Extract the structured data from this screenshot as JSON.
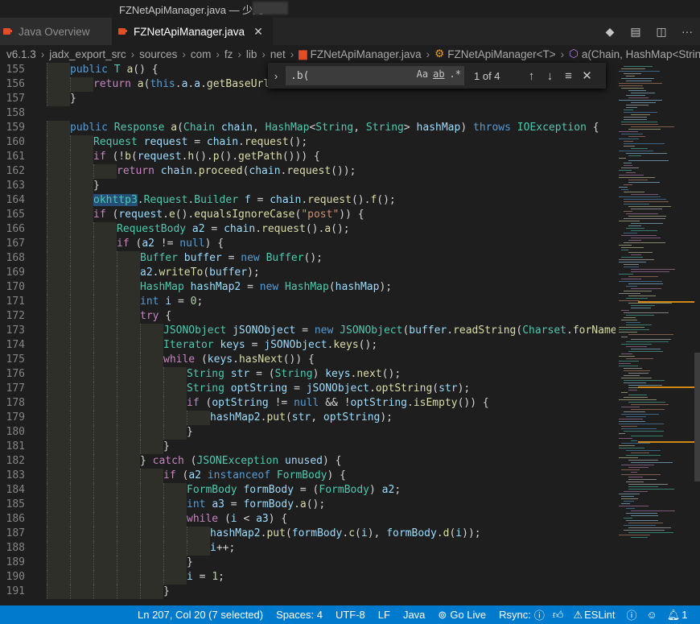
{
  "window": {
    "title": "FZNetApiManager.java — 少儿"
  },
  "tabs": [
    {
      "label": "Java Overview",
      "active": false
    },
    {
      "label": "FZNetApiManager.java",
      "active": true
    }
  ],
  "tab_actions": [
    "git-compare-icon",
    "open-preview-icon",
    "split-editor-icon",
    "more-actions-icon"
  ],
  "breadcrumb": [
    "v6.1.3",
    "jadx_export_src",
    "sources",
    "com",
    "fz",
    "lib",
    "net",
    "FZNetApiManager.java",
    "FZNetApiManager<T>",
    "a(Chain, HashMap<Strin"
  ],
  "find": {
    "query": ".b(",
    "match_case": "Aa",
    "whole_word": "ab",
    "regex": ".*",
    "count": "1 of 4"
  },
  "code_lines": [
    {
      "n": "155",
      "indent": 1,
      "tokens": [
        [
          "kw",
          "public "
        ],
        [
          "ty",
          "T "
        ],
        [
          "fn",
          "a"
        ],
        [
          "pl",
          "() {"
        ]
      ]
    },
    {
      "n": "156",
      "indent": 2,
      "tokens": [
        [
          "ctl",
          "return "
        ],
        [
          "fn",
          "a"
        ],
        [
          "pl",
          "("
        ],
        [
          "kw",
          "this"
        ],
        [
          "pl",
          "."
        ],
        [
          "var",
          "a"
        ],
        [
          "pl",
          "."
        ],
        [
          "var",
          "a"
        ],
        [
          "pl",
          "."
        ],
        [
          "fn",
          "getBaseUrl"
        ],
        [
          "pl",
          "()"
        ]
      ]
    },
    {
      "n": "157",
      "indent": 1,
      "tokens": [
        [
          "pl",
          "}"
        ]
      ]
    },
    {
      "n": "158",
      "indent": 0,
      "tokens": []
    },
    {
      "n": "159",
      "indent": 1,
      "tokens": [
        [
          "kw",
          "public "
        ],
        [
          "ty",
          "Response "
        ],
        [
          "fn",
          "a"
        ],
        [
          "pl",
          "("
        ],
        [
          "ty",
          "Chain "
        ],
        [
          "var",
          "chain"
        ],
        [
          "pl",
          ", "
        ],
        [
          "ty",
          "HashMap"
        ],
        [
          "pl",
          "<"
        ],
        [
          "ty",
          "String"
        ],
        [
          "pl",
          ", "
        ],
        [
          "ty",
          "String"
        ],
        [
          "pl",
          "> "
        ],
        [
          "var",
          "hashMap"
        ],
        [
          "pl",
          ") "
        ],
        [
          "kw",
          "throws "
        ],
        [
          "ty",
          "IOException"
        ],
        [
          "pl",
          " {"
        ]
      ]
    },
    {
      "n": "160",
      "indent": 2,
      "tokens": [
        [
          "ty",
          "Request "
        ],
        [
          "var",
          "request"
        ],
        [
          "pl",
          " = "
        ],
        [
          "var",
          "chain"
        ],
        [
          "pl",
          "."
        ],
        [
          "fn",
          "request"
        ],
        [
          "pl",
          "();"
        ]
      ]
    },
    {
      "n": "161",
      "indent": 2,
      "tokens": [
        [
          "ctl",
          "if "
        ],
        [
          "pl",
          "(!"
        ],
        [
          "fn",
          "b"
        ],
        [
          "pl",
          "("
        ],
        [
          "var",
          "request"
        ],
        [
          "pl",
          "."
        ],
        [
          "fn",
          "h"
        ],
        [
          "pl",
          "()."
        ],
        [
          "fn",
          "p"
        ],
        [
          "pl",
          "()."
        ],
        [
          "fn",
          "getPath"
        ],
        [
          "pl",
          "())) {"
        ]
      ]
    },
    {
      "n": "162",
      "indent": 3,
      "tokens": [
        [
          "ctl",
          "return "
        ],
        [
          "var",
          "chain"
        ],
        [
          "pl",
          "."
        ],
        [
          "fn",
          "proceed"
        ],
        [
          "pl",
          "("
        ],
        [
          "var",
          "chain"
        ],
        [
          "pl",
          "."
        ],
        [
          "fn",
          "request"
        ],
        [
          "pl",
          "());"
        ]
      ]
    },
    {
      "n": "163",
      "indent": 2,
      "tokens": [
        [
          "pl",
          "}"
        ]
      ]
    },
    {
      "n": "164",
      "indent": 2,
      "tokens": [
        [
          "sel",
          "okhttp3"
        ],
        [
          "pl",
          "."
        ],
        [
          "ty",
          "Request"
        ],
        [
          "pl",
          "."
        ],
        [
          "ty",
          "Builder "
        ],
        [
          "var",
          "f"
        ],
        [
          "pl",
          " = "
        ],
        [
          "var",
          "chain"
        ],
        [
          "pl",
          "."
        ],
        [
          "fn",
          "request"
        ],
        [
          "pl",
          "()."
        ],
        [
          "fn",
          "f"
        ],
        [
          "pl",
          "();"
        ]
      ]
    },
    {
      "n": "165",
      "indent": 2,
      "tokens": [
        [
          "ctl",
          "if "
        ],
        [
          "pl",
          "("
        ],
        [
          "var",
          "request"
        ],
        [
          "pl",
          "."
        ],
        [
          "fn",
          "e"
        ],
        [
          "pl",
          "()."
        ],
        [
          "fn",
          "equalsIgnoreCase"
        ],
        [
          "pl",
          "("
        ],
        [
          "str",
          "\"post\""
        ],
        [
          "pl",
          ")) {"
        ]
      ]
    },
    {
      "n": "166",
      "indent": 3,
      "tokens": [
        [
          "ty",
          "RequestBody "
        ],
        [
          "var",
          "a2"
        ],
        [
          "pl",
          " = "
        ],
        [
          "var",
          "chain"
        ],
        [
          "pl",
          "."
        ],
        [
          "fn",
          "request"
        ],
        [
          "pl",
          "()."
        ],
        [
          "fn",
          "a"
        ],
        [
          "pl",
          "();"
        ]
      ]
    },
    {
      "n": "167",
      "indent": 3,
      "tokens": [
        [
          "ctl",
          "if "
        ],
        [
          "pl",
          "("
        ],
        [
          "var",
          "a2"
        ],
        [
          "pl",
          " != "
        ],
        [
          "kw",
          "null"
        ],
        [
          "pl",
          ") {"
        ]
      ]
    },
    {
      "n": "168",
      "indent": 4,
      "tokens": [
        [
          "ty",
          "Buffer "
        ],
        [
          "var",
          "buffer"
        ],
        [
          "pl",
          " = "
        ],
        [
          "kw",
          "new "
        ],
        [
          "ty",
          "Buffer"
        ],
        [
          "pl",
          "();"
        ]
      ]
    },
    {
      "n": "169",
      "indent": 4,
      "tokens": [
        [
          "var",
          "a2"
        ],
        [
          "pl",
          "."
        ],
        [
          "fn",
          "writeTo"
        ],
        [
          "pl",
          "("
        ],
        [
          "var",
          "buffer"
        ],
        [
          "pl",
          ");"
        ]
      ]
    },
    {
      "n": "170",
      "indent": 4,
      "tokens": [
        [
          "ty",
          "HashMap "
        ],
        [
          "var",
          "hashMap2"
        ],
        [
          "pl",
          " = "
        ],
        [
          "kw",
          "new "
        ],
        [
          "ty",
          "HashMap"
        ],
        [
          "pl",
          "("
        ],
        [
          "var",
          "hashMap"
        ],
        [
          "pl",
          ");"
        ]
      ]
    },
    {
      "n": "171",
      "indent": 4,
      "tokens": [
        [
          "kw",
          "int "
        ],
        [
          "var",
          "i"
        ],
        [
          "pl",
          " = "
        ],
        [
          "num",
          "0"
        ],
        [
          "pl",
          ";"
        ]
      ]
    },
    {
      "n": "172",
      "indent": 4,
      "tokens": [
        [
          "ctl",
          "try "
        ],
        [
          "pl",
          "{"
        ]
      ]
    },
    {
      "n": "173",
      "indent": 5,
      "tokens": [
        [
          "ty",
          "JSONObject "
        ],
        [
          "var",
          "jSONObject"
        ],
        [
          "pl",
          " = "
        ],
        [
          "kw",
          "new "
        ],
        [
          "ty",
          "JSONObject"
        ],
        [
          "pl",
          "("
        ],
        [
          "var",
          "buffer"
        ],
        [
          "pl",
          "."
        ],
        [
          "fn",
          "readString"
        ],
        [
          "pl",
          "("
        ],
        [
          "ty",
          "Charset"
        ],
        [
          "pl",
          "."
        ],
        [
          "fn",
          "forName"
        ],
        [
          "pl",
          "("
        ],
        [
          "str",
          "\"UTF-"
        ]
      ]
    },
    {
      "n": "174",
      "indent": 5,
      "tokens": [
        [
          "ty",
          "Iterator "
        ],
        [
          "var",
          "keys"
        ],
        [
          "pl",
          " = "
        ],
        [
          "var",
          "jSONObject"
        ],
        [
          "pl",
          "."
        ],
        [
          "fn",
          "keys"
        ],
        [
          "pl",
          "();"
        ]
      ]
    },
    {
      "n": "175",
      "indent": 5,
      "tokens": [
        [
          "ctl",
          "while "
        ],
        [
          "pl",
          "("
        ],
        [
          "var",
          "keys"
        ],
        [
          "pl",
          "."
        ],
        [
          "fn",
          "hasNext"
        ],
        [
          "pl",
          "()) {"
        ]
      ]
    },
    {
      "n": "176",
      "indent": 6,
      "tokens": [
        [
          "ty",
          "String "
        ],
        [
          "var",
          "str"
        ],
        [
          "pl",
          " = ("
        ],
        [
          "ty",
          "String"
        ],
        [
          "pl",
          ") "
        ],
        [
          "var",
          "keys"
        ],
        [
          "pl",
          "."
        ],
        [
          "fn",
          "next"
        ],
        [
          "pl",
          "();"
        ]
      ]
    },
    {
      "n": "177",
      "indent": 6,
      "tokens": [
        [
          "ty",
          "String "
        ],
        [
          "var",
          "optString"
        ],
        [
          "pl",
          " = "
        ],
        [
          "var",
          "jSONObject"
        ],
        [
          "pl",
          "."
        ],
        [
          "fn",
          "optString"
        ],
        [
          "pl",
          "("
        ],
        [
          "var",
          "str"
        ],
        [
          "pl",
          ");"
        ]
      ]
    },
    {
      "n": "178",
      "indent": 6,
      "tokens": [
        [
          "ctl",
          "if "
        ],
        [
          "pl",
          "("
        ],
        [
          "var",
          "optString"
        ],
        [
          "pl",
          " != "
        ],
        [
          "kw",
          "null"
        ],
        [
          "pl",
          " && !"
        ],
        [
          "var",
          "optString"
        ],
        [
          "pl",
          "."
        ],
        [
          "fn",
          "isEmpty"
        ],
        [
          "pl",
          "()) {"
        ]
      ]
    },
    {
      "n": "179",
      "indent": 7,
      "tokens": [
        [
          "var",
          "hashMap2"
        ],
        [
          "pl",
          "."
        ],
        [
          "fn",
          "put"
        ],
        [
          "pl",
          "("
        ],
        [
          "var",
          "str"
        ],
        [
          "pl",
          ", "
        ],
        [
          "var",
          "optString"
        ],
        [
          "pl",
          ");"
        ]
      ]
    },
    {
      "n": "180",
      "indent": 6,
      "tokens": [
        [
          "pl",
          "}"
        ]
      ]
    },
    {
      "n": "181",
      "indent": 5,
      "tokens": [
        [
          "pl",
          "}"
        ]
      ]
    },
    {
      "n": "182",
      "indent": 4,
      "tokens": [
        [
          "pl",
          "} "
        ],
        [
          "ctl",
          "catch "
        ],
        [
          "pl",
          "("
        ],
        [
          "ty",
          "JSONException "
        ],
        [
          "var",
          "unused"
        ],
        [
          "pl",
          ") {"
        ]
      ]
    },
    {
      "n": "183",
      "indent": 5,
      "tokens": [
        [
          "ctl",
          "if "
        ],
        [
          "pl",
          "("
        ],
        [
          "var",
          "a2"
        ],
        [
          "kw",
          " instanceof "
        ],
        [
          "ty",
          "FormBody"
        ],
        [
          "pl",
          ") {"
        ]
      ]
    },
    {
      "n": "184",
      "indent": 6,
      "tokens": [
        [
          "ty",
          "FormBody "
        ],
        [
          "var",
          "formBody"
        ],
        [
          "pl",
          " = ("
        ],
        [
          "ty",
          "FormBody"
        ],
        [
          "pl",
          ") "
        ],
        [
          "var",
          "a2"
        ],
        [
          "pl",
          ";"
        ]
      ]
    },
    {
      "n": "185",
      "indent": 6,
      "tokens": [
        [
          "kw",
          "int "
        ],
        [
          "var",
          "a3"
        ],
        [
          "pl",
          " = "
        ],
        [
          "var",
          "formBody"
        ],
        [
          "pl",
          "."
        ],
        [
          "fn",
          "a"
        ],
        [
          "pl",
          "();"
        ]
      ]
    },
    {
      "n": "186",
      "indent": 6,
      "tokens": [
        [
          "ctl",
          "while "
        ],
        [
          "pl",
          "("
        ],
        [
          "var",
          "i"
        ],
        [
          "pl",
          " < "
        ],
        [
          "var",
          "a3"
        ],
        [
          "pl",
          ") {"
        ]
      ]
    },
    {
      "n": "187",
      "indent": 7,
      "tokens": [
        [
          "var",
          "hashMap2"
        ],
        [
          "pl",
          "."
        ],
        [
          "fn",
          "put"
        ],
        [
          "pl",
          "("
        ],
        [
          "var",
          "formBody"
        ],
        [
          "pl",
          "."
        ],
        [
          "fn",
          "c"
        ],
        [
          "pl",
          "("
        ],
        [
          "var",
          "i"
        ],
        [
          "pl",
          "), "
        ],
        [
          "var",
          "formBody"
        ],
        [
          "pl",
          "."
        ],
        [
          "fn",
          "d"
        ],
        [
          "pl",
          "("
        ],
        [
          "var",
          "i"
        ],
        [
          "pl",
          "));"
        ]
      ]
    },
    {
      "n": "188",
      "indent": 7,
      "tokens": [
        [
          "var",
          "i"
        ],
        [
          "pl",
          "++;"
        ]
      ]
    },
    {
      "n": "189",
      "indent": 6,
      "tokens": [
        [
          "pl",
          "}"
        ]
      ]
    },
    {
      "n": "190",
      "indent": 6,
      "tokens": [
        [
          "var",
          "i"
        ],
        [
          "pl",
          " = "
        ],
        [
          "num",
          "1"
        ],
        [
          "pl",
          ";"
        ]
      ]
    },
    {
      "n": "191",
      "indent": 5,
      "tokens": [
        [
          "pl",
          "}"
        ]
      ]
    }
  ],
  "status": {
    "position": "Ln 207, Col 20 (7 selected)",
    "spaces": "Spaces: 4",
    "encoding": "UTF-8",
    "eol": "LF",
    "language": "Java",
    "go_live": "Go Live",
    "rsync": "Rsync:",
    "eslint": "ESLint",
    "bell_count": "1"
  }
}
